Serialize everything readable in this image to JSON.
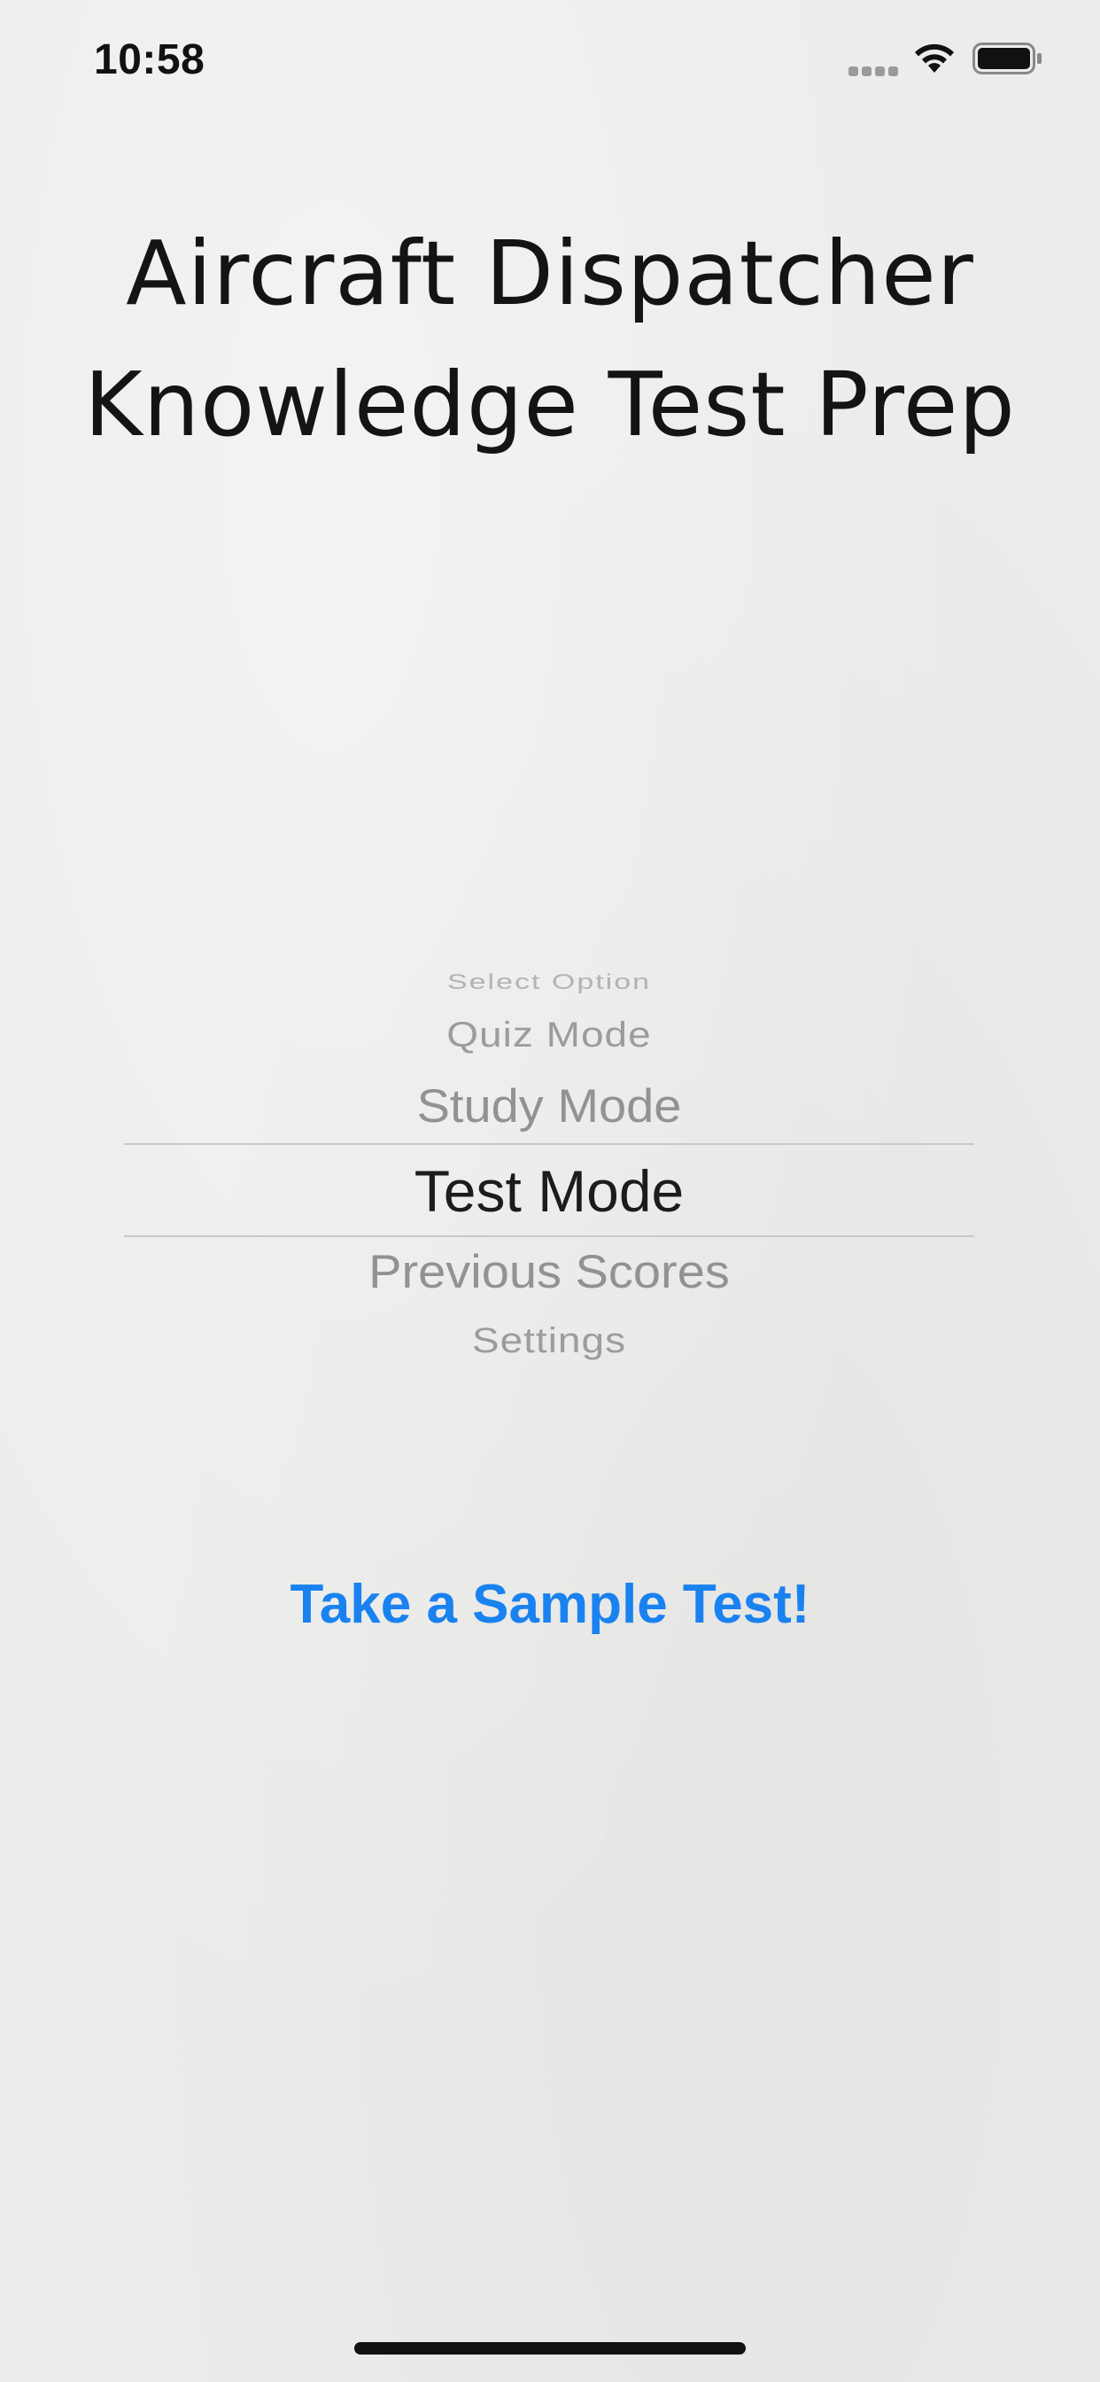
{
  "status_bar": {
    "time": "10:58",
    "icons": [
      "cellular-signal-icon",
      "wifi-icon",
      "battery-icon"
    ]
  },
  "title": "Aircraft Dispatcher Knowledge Test Prep",
  "picker": {
    "options": [
      "Select Option",
      "Quiz Mode",
      "Study Mode",
      "Test Mode",
      "Previous Scores",
      "Settings"
    ],
    "selected": "Test Mode"
  },
  "sample_test_label": "Take a Sample Test!",
  "colors": {
    "background": "#ececea",
    "accent": "#1a82f0",
    "text": "#141414",
    "picker_faded": "#929290"
  }
}
